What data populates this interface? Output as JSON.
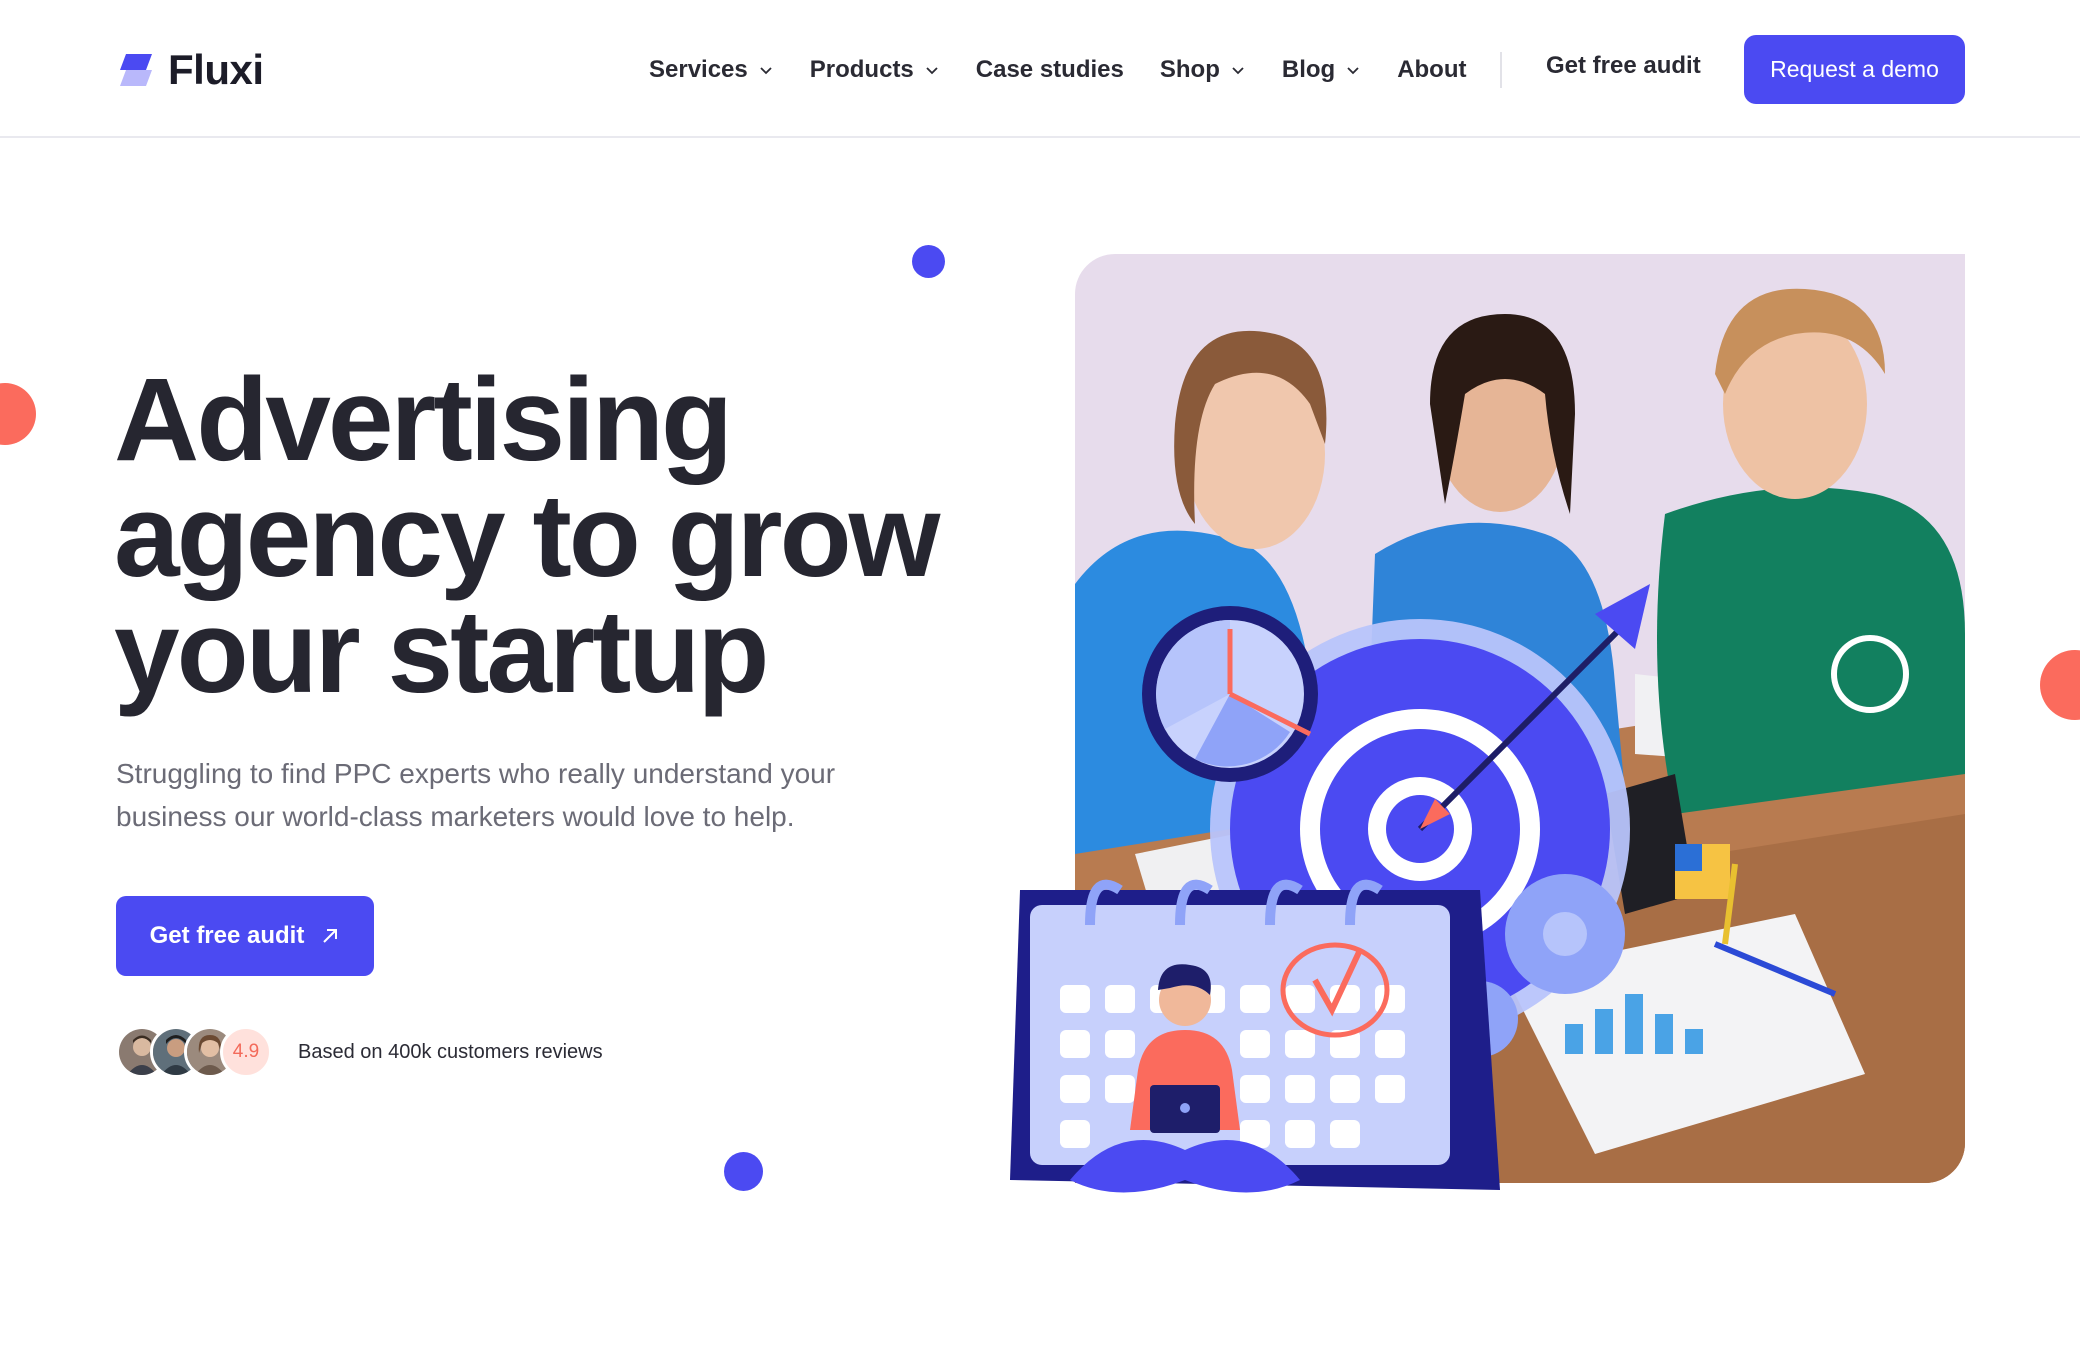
{
  "brand": {
    "name": "Fluxi",
    "accent": "#4b4af2",
    "coral": "#fb6b5d"
  },
  "nav": {
    "items": [
      {
        "label": "Services",
        "has_dropdown": true
      },
      {
        "label": "Products",
        "has_dropdown": true
      },
      {
        "label": "Case studies",
        "has_dropdown": false
      },
      {
        "label": "Shop",
        "has_dropdown": true
      },
      {
        "label": "Blog",
        "has_dropdown": true
      },
      {
        "label": "About",
        "has_dropdown": false
      }
    ],
    "audit_link": "Get free audit",
    "demo_button": "Request a demo"
  },
  "hero": {
    "title_lines": [
      "Advertising",
      "agency to grow",
      "your startup"
    ],
    "subtitle": "Struggling to find PPC experts who really understand your business our world-class marketers would love to help.",
    "cta": "Get free audit",
    "rating": "4.9",
    "reviews_text": "Based on 400k customers reviews"
  },
  "icons": {
    "logo": "fluxi-logo-icon",
    "dropdown": "chevron-down-icon",
    "cta_arrow": "arrow-up-right-icon"
  }
}
